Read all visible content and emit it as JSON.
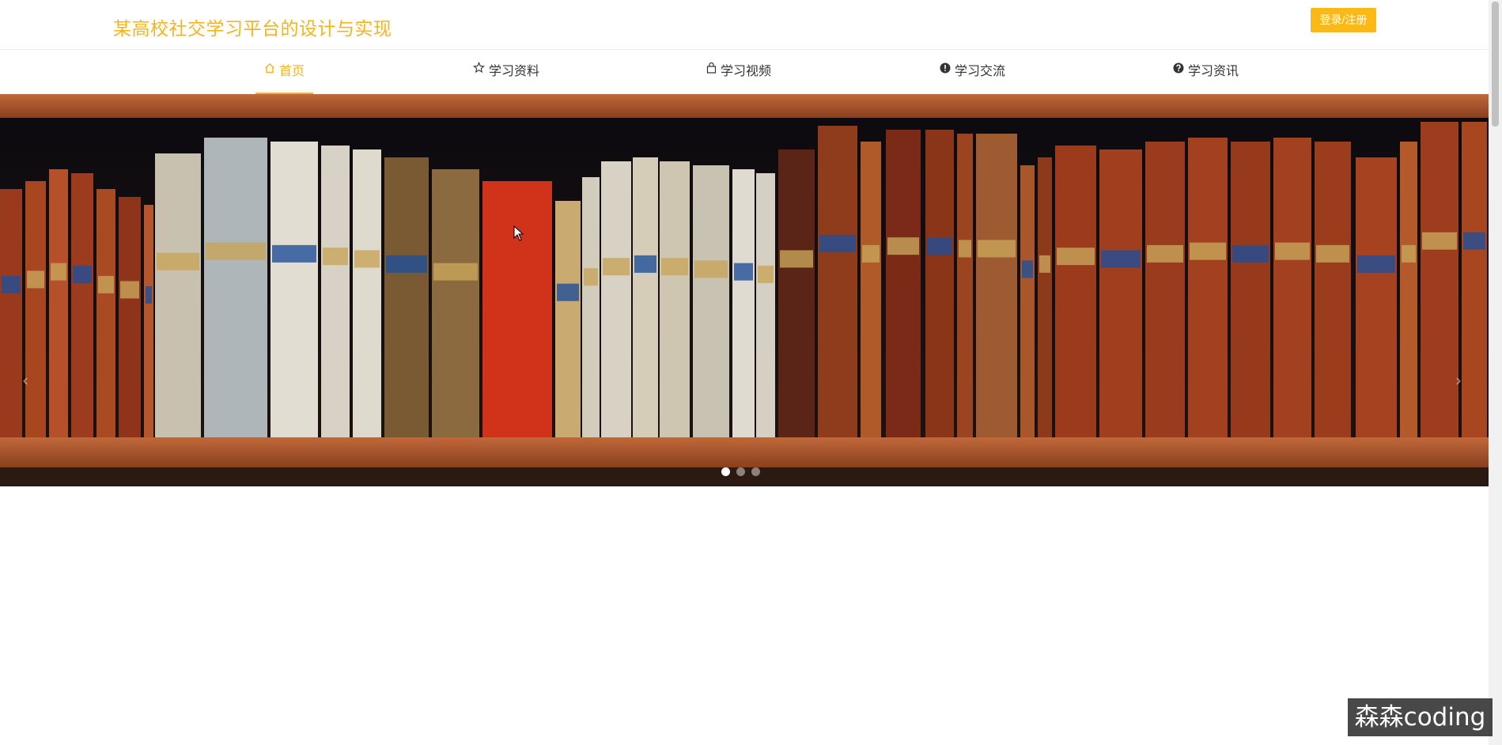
{
  "header": {
    "site_title": "某高校社交学习平台的设计与实现",
    "login_label": "登录/注册",
    "accent_color": "#f5b41b"
  },
  "nav": {
    "items": [
      {
        "label": "首页",
        "icon": "home-icon",
        "active": true
      },
      {
        "label": "学习资料",
        "icon": "star-icon",
        "active": false
      },
      {
        "label": "学习视频",
        "icon": "bag-icon",
        "active": false
      },
      {
        "label": "学习交流",
        "icon": "exclamation-circle-icon",
        "active": false
      },
      {
        "label": "学习资讯",
        "icon": "question-circle-icon",
        "active": false
      }
    ]
  },
  "banner": {
    "image": "bookshelf-photo",
    "prev_arrow": "‹",
    "next_arrow": "›",
    "slide_count": 3,
    "active_slide": 1
  },
  "watermark": {
    "text": "森森coding"
  }
}
